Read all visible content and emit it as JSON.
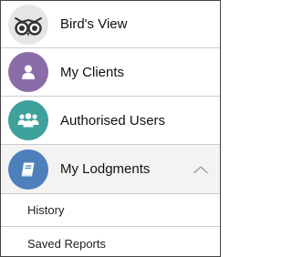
{
  "menu": {
    "birds_view": {
      "label": "Bird's View",
      "icon": "owl-icon",
      "color": "#e6e6e6"
    },
    "my_clients": {
      "label": "My Clients",
      "icon": "user-icon",
      "color": "#8a6ca8"
    },
    "authorised_users": {
      "label": "Authorised Users",
      "icon": "users-group-icon",
      "color": "#3fa19b"
    },
    "my_lodgments": {
      "label": "My Lodgments",
      "icon": "book-icon",
      "color": "#4e7fbd",
      "expanded": true
    },
    "submenu": [
      {
        "label": "History"
      },
      {
        "label": "Saved Reports"
      }
    ]
  },
  "colors": {
    "divider": "#cccccc",
    "active_row_bg": "#f3f3f3",
    "chevron": "#9a9a9a"
  }
}
